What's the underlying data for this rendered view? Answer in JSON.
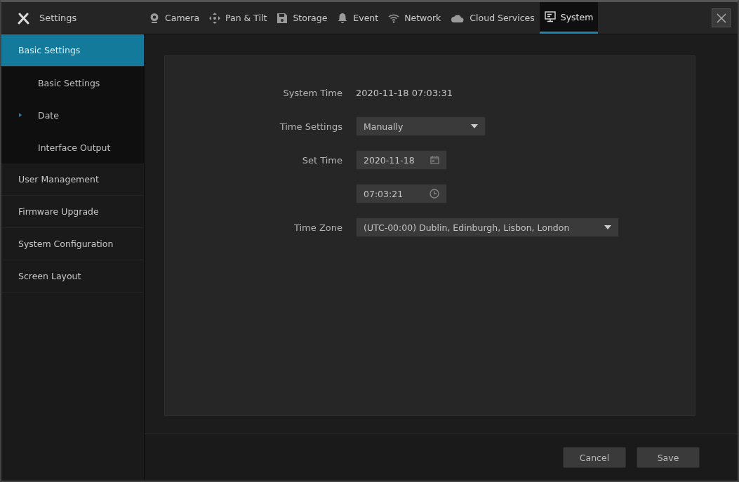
{
  "header": {
    "title": "Settings"
  },
  "tabs": [
    {
      "label": "Camera",
      "kind": "camera",
      "selected": false
    },
    {
      "label": "Pan & Tilt",
      "kind": "pan",
      "selected": false
    },
    {
      "label": "Storage",
      "kind": "disk",
      "selected": false
    },
    {
      "label": "Event",
      "kind": "bell",
      "selected": false
    },
    {
      "label": "Network",
      "kind": "wifi",
      "selected": false
    },
    {
      "label": "Cloud Services",
      "kind": "cloud",
      "selected": false
    },
    {
      "label": "System",
      "kind": "monitor",
      "selected": true
    }
  ],
  "sidebar": {
    "items": [
      {
        "label": "Basic Settings",
        "selected": true,
        "children": [
          {
            "label": "Basic Settings",
            "selected": false
          },
          {
            "label": "Date",
            "selected": true
          },
          {
            "label": "Interface Output",
            "selected": false
          }
        ]
      },
      {
        "label": "User Management",
        "selected": false
      },
      {
        "label": "Firmware Upgrade",
        "selected": false
      },
      {
        "label": "System Configuration",
        "selected": false
      },
      {
        "label": "Screen Layout",
        "selected": false
      }
    ]
  },
  "form": [
    {
      "kind": "text",
      "label": "System Time",
      "value": "2020-11-18 07:03:31"
    },
    {
      "kind": "select",
      "label": "Time Settings",
      "value": "Manually"
    },
    {
      "kind": "date",
      "label": "Set Time",
      "value": "2020-11-18"
    },
    {
      "kind": "time",
      "value": "07:03:21"
    },
    {
      "kind": "select",
      "label": "Time Zone",
      "value": "(UTC-00:00) Dublin, Edinburgh, Lisbon, London"
    }
  ],
  "buttons": [
    "Cancel",
    "Save"
  ]
}
